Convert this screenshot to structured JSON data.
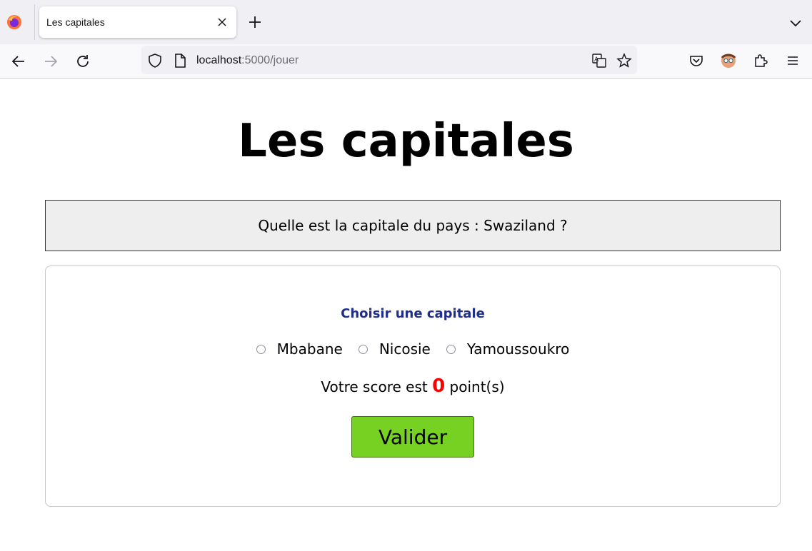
{
  "browser": {
    "tab_title": "Les capitales",
    "url_host": "localhost",
    "url_path": ":5000/jouer",
    "icons": {
      "logo": "firefox-logo-icon",
      "close_tab": "close-icon",
      "new_tab": "plus-icon",
      "tab_list": "chevron-down-icon",
      "back": "arrow-left-icon",
      "forward": "arrow-right-icon",
      "reload": "reload-icon",
      "shield": "shield-icon",
      "page_info": "page-icon",
      "translate": "translate-icon",
      "bookmark": "star-icon",
      "pocket": "pocket-icon",
      "account": "avatar-icon",
      "extensions": "puzzle-icon",
      "menu": "hamburger-menu-icon"
    }
  },
  "page": {
    "title": "Les capitales",
    "question": "Quelle est la capitale du pays : Swaziland ?",
    "choose_label": "Choisir une capitale",
    "options": [
      "Mbabane",
      "Nicosie",
      "Yamoussoukro"
    ],
    "score_prefix": "Votre score est",
    "score_value": "0",
    "score_suffix": "point(s)",
    "submit_label": "Valider"
  },
  "colors": {
    "accent_button": "#76d123",
    "score_color": "#ff0000",
    "label_color": "#1f2d8a"
  }
}
